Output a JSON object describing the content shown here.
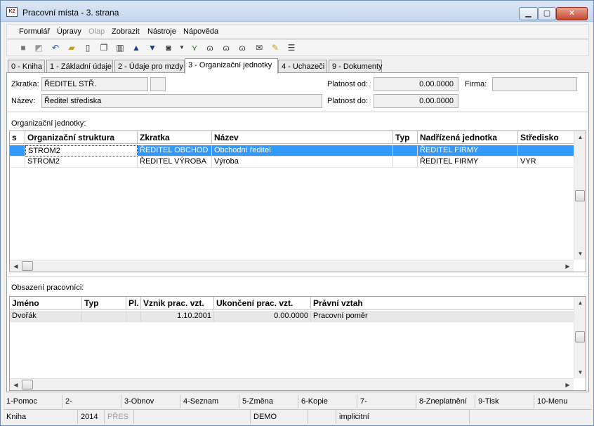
{
  "window": {
    "title": "Pracovní místa - 3. strana",
    "icon_text": "K2",
    "min": "▁",
    "max": "▢",
    "close": "✕"
  },
  "menu": [
    "Formulář",
    "Úpravy",
    "Olap",
    "Zobrazit",
    "Nástroje",
    "Nápověda"
  ],
  "toolbar_icons": [
    "save-icon",
    "save-as-icon",
    "undo-icon",
    "open-folder-icon",
    "new-document-icon",
    "copy-icon",
    "book-icon",
    "arrow-up-icon",
    "arrow-down-icon",
    "camera-icon",
    "dropdown-icon",
    "filter-icon",
    "binoculars-icon",
    "binoculars-next-icon",
    "binoculars-all-icon",
    "mail-icon",
    "edit-folder-icon",
    "menu-lines-icon"
  ],
  "tabs": [
    "0 - Kniha",
    "1 - Základní údaje",
    "2 - Údaje pro mzdy",
    "3 - Organizační jednotky",
    "4 - Uchazeči",
    "9 - Dokumenty"
  ],
  "header": {
    "zkratka_label": "Zkratka:",
    "zkratka_value": "ŘEDITEL STŘ.",
    "nazev_label": "Název:",
    "nazev_value": "Ředitel střediska",
    "platnost_od_label": "Platnost od:",
    "platnost_od_value": "0.00.0000",
    "platnost_do_label": "Platnost do:",
    "platnost_do_value": "0.00.0000",
    "firma_label": "Firma:",
    "firma_value": ""
  },
  "org_units": {
    "section_label": "Organizační jednotky:",
    "columns": [
      "s",
      "Organizační struktura",
      "Zkratka",
      "Název",
      "Typ",
      "Nadřízená jednotka",
      "Středisko"
    ],
    "rows": [
      [
        "",
        "STROM2",
        "ŘEDITEL OBCHOD",
        "Obchodní ředitel",
        "",
        "ŘEDITEL FIRMY",
        ""
      ],
      [
        "",
        "STROM2",
        "ŘEDITEL VÝROBA",
        "Výroba",
        "",
        "ŘEDITEL FIRMY",
        "VYR"
      ]
    ]
  },
  "employees": {
    "section_label": "Obsazení pracovníci:",
    "columns": [
      "Jméno",
      "Typ",
      "Pl.",
      "Vznik prac. vzt.",
      "Ukončení prac. vzt.",
      "Právní vztah"
    ],
    "rows": [
      [
        "Dvořák",
        "",
        "",
        "1.10.2001",
        "0.00.0000",
        "Pracovní poměr"
      ]
    ]
  },
  "fkeys": [
    "1-Pomoc",
    "2-",
    "3-Obnov",
    "4-Seznam",
    "5-Změna",
    "6-Kopie",
    "7-",
    "8-Zneplatnění",
    "9-Tisk",
    "10-Menu"
  ],
  "status": [
    "Kniha",
    "2014",
    "PŘES",
    "",
    "DEMO",
    "",
    "implicitní",
    ""
  ],
  "colors": {
    "selection": "#3399ff",
    "titlebar": "#c3d6ee",
    "close_button": "#c5462c"
  }
}
